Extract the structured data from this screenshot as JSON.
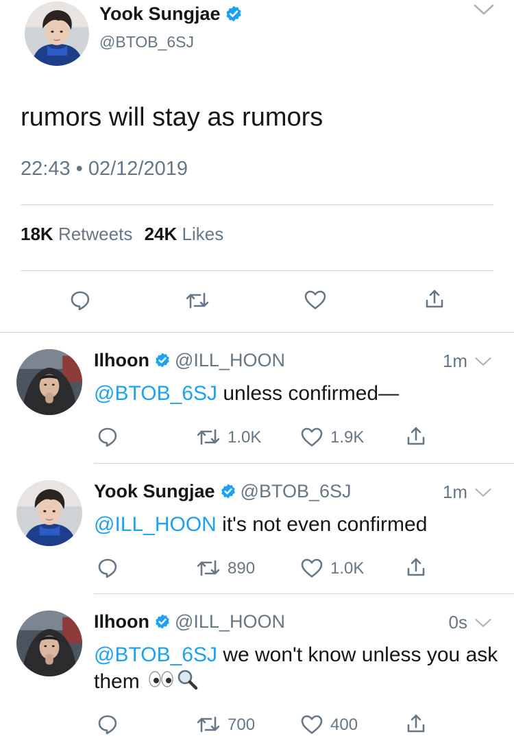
{
  "main_tweet": {
    "name": "Yook Sungjae",
    "handle": "@BTOB_6SJ",
    "text": "rumors will stay as rumors",
    "timestamp": "22:43 • 02/12/2019",
    "retweets_count": "18K",
    "retweets_label": "Retweets",
    "likes_count": "24K",
    "likes_label": "Likes",
    "avatar": "avatar-yook-sungjae"
  },
  "replies": [
    {
      "name": "Ilhoon",
      "handle": "@ILL_HOON",
      "time": "1m",
      "mention": "@BTOB_6SJ",
      "text": " unless confirmed—",
      "retweets": "1.0K",
      "likes": "1.9K",
      "avatar": "avatar-ilhoon"
    },
    {
      "name": "Yook Sungjae",
      "handle": "@BTOB_6SJ",
      "time": "1m",
      "mention": "@ILL_HOON",
      "text": " it's not even confirmed",
      "retweets": "890",
      "likes": "1.0K",
      "avatar": "avatar-yook-sungjae"
    },
    {
      "name": "Ilhoon",
      "handle": "@ILL_HOON",
      "time": "0s",
      "mention": "@BTOB_6SJ",
      "text": " we won't know unless you ask them",
      "emoji": "eyes-magnifier-emoji",
      "retweets": "700",
      "likes": "400",
      "avatar": "avatar-ilhoon"
    }
  ],
  "colors": {
    "accent": "#1da1f2",
    "secondary_text": "#657786",
    "divider": "#d4d9dd",
    "icon": "#657786"
  },
  "icons": [
    "verified-badge-icon",
    "chevron-down-icon",
    "reply-icon",
    "retweet-icon",
    "like-icon",
    "share-icon"
  ]
}
